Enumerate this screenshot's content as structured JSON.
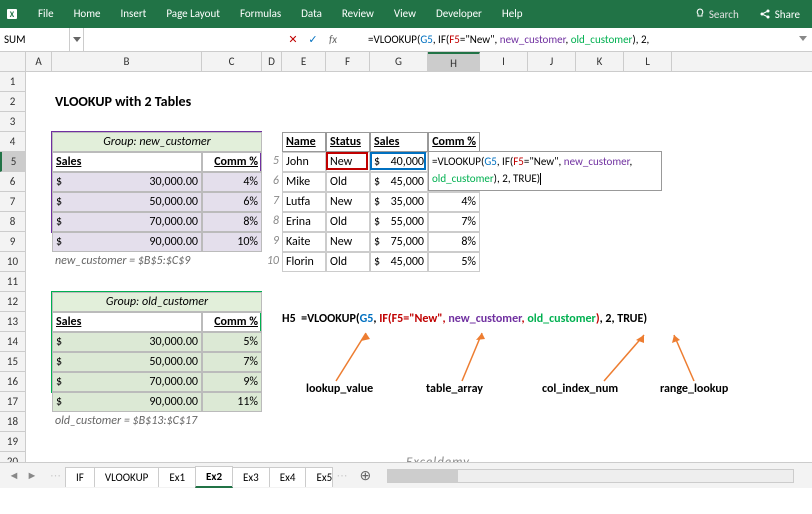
{
  "ribbon": {
    "tabs": [
      "File",
      "Home",
      "Insert",
      "Page Layout",
      "Formulas",
      "Data",
      "Review",
      "View",
      "Developer",
      "Help"
    ],
    "search": "Search",
    "share": "Share"
  },
  "formula_bar": {
    "name_box": "SUM",
    "formula_raw": "=VLOOKUP(G5, IF(F5=\"New\", new_customer, old_customer), 2,"
  },
  "title": "VLOOKUP with 2 Tables",
  "group_new": {
    "header": "Group: new_customer",
    "col1": "Sales",
    "col2": "Comm %",
    "rows": [
      {
        "s": "$",
        "v": "30,000.00",
        "c": "4%"
      },
      {
        "s": "$",
        "v": "50,000.00",
        "c": "6%"
      },
      {
        "s": "$",
        "v": "70,000.00",
        "c": "8%"
      },
      {
        "s": "$",
        "v": "90,000.00",
        "c": "10%"
      }
    ],
    "note": "new_customer = $B$5:$C$9"
  },
  "group_old": {
    "header": "Group: old_customer",
    "col1": "Sales",
    "col2": "Comm %",
    "rows": [
      {
        "s": "$",
        "v": "30,000.00",
        "c": "5%"
      },
      {
        "s": "$",
        "v": "50,000.00",
        "c": "7%"
      },
      {
        "s": "$",
        "v": "70,000.00",
        "c": "9%"
      },
      {
        "s": "$",
        "v": "90,000.00",
        "c": "11%"
      }
    ],
    "note": "old_customer = $B$13:$C$17"
  },
  "data_table": {
    "h": [
      "Name",
      "Status",
      "Sales",
      "Comm %"
    ],
    "rnum": [
      5,
      6,
      7,
      8,
      9,
      10
    ],
    "rows": [
      {
        "n": "John",
        "st": "New",
        "sv": "40,000",
        "c": ""
      },
      {
        "n": "Mike",
        "st": "Old",
        "sv": "45,000",
        "c": "old_customer), 2, TRUE)"
      },
      {
        "n": "Lutfa",
        "st": "New",
        "sv": "35,000",
        "c": "4%"
      },
      {
        "n": "Erina",
        "st": "Old",
        "sv": "55,000",
        "c": "7%"
      },
      {
        "n": "Kaite",
        "st": "New",
        "sv": "75,000",
        "c": "8%"
      },
      {
        "n": "Florin",
        "st": "Old",
        "sv": "45,000",
        "c": "5%"
      }
    ]
  },
  "overlay_formula_line1": "=VLOOKUP(G5, IF(F5=\"New\", new_customer,",
  "anno": {
    "ref": "H5",
    "full": "=VLOOKUP(G5, IF(F5=\"New\", new_customer, old_customer), 2, TRUE)",
    "labels": [
      "lookup_value",
      "table_array",
      "col_index_num",
      "range_lookup"
    ]
  },
  "watermark": "Exceldemy",
  "sheets": [
    "IF",
    "VLOOKUP",
    "Ex1",
    "Ex2",
    "Ex3",
    "Ex4",
    "Ex5"
  ],
  "active_sheet": "Ex2",
  "cols": {
    "A": 26,
    "B": 150,
    "C": 60,
    "D": 20,
    "E": 44,
    "F": 44,
    "G": 58,
    "H": 52,
    "I": 48,
    "J": 48,
    "K": 48,
    "L": 48
  },
  "col_labels": [
    "A",
    "B",
    "C",
    "D",
    "E",
    "F",
    "G",
    "H",
    "I",
    "J",
    "K",
    "L"
  ]
}
